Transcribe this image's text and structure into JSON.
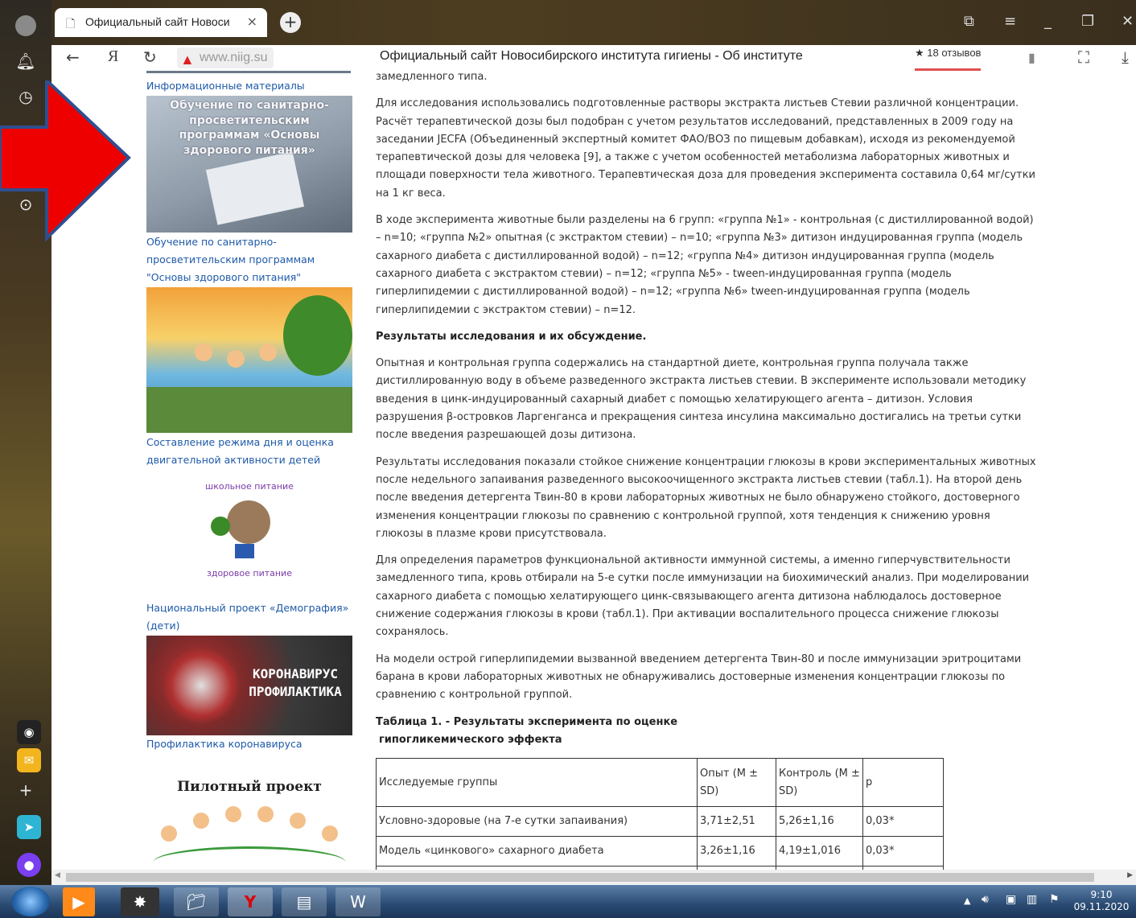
{
  "browser": {
    "tab_title": "Официальный сайт Новоси",
    "url": "www.niig.su",
    "page_title": "Официальный сайт Новосибирского института гигиены - Об институте",
    "reviews": "18 отзывов"
  },
  "sidebar_left": {
    "top_link": "Информационные материалы",
    "banner1_title": "Обучение по санитарно-просветительским программам «Основы здорового питания»",
    "link1": "Обучение по санитарно-просветительским программам \"Основы здорового питания\"",
    "link2": "Составление режима дня и оценка двигательной активности детей",
    "logo_top_text": "школьное питание",
    "logo_bottom_text": "здоровое питание",
    "link3": "Национальный проект «Демография» (дети)",
    "covid_text_1": "КОРОНАВИРУС",
    "covid_text_2": "ПРОФИЛАКТИКА",
    "link4": "Профилактика коронавируса",
    "pilot": "Пилотный проект"
  },
  "article": {
    "p0": "замедленного типа.",
    "p1": "Для исследования использовались подготовленные растворы экстракта листьев Стевии различной концентрации. Расчёт терапевтической дозы был подобран с учетом результатов исследований, представленных в 2009 году на заседании JECFA (Объединенный экспертный комитет ФАО/ВОЗ по пищевым добавкам), исходя из рекомендуемой терапевтической дозы для человека [9], а также с учетом особенностей метаболизма лабораторных животных и площади поверхности тела животного. Терапевтическая доза для проведения эксперимента составила 0,64 мг/сутки на 1 кг веса.",
    "p2": "В ходе эксперимента животные были разделены на 6 групп: «группа №1» - контрольная (с дистиллированной водой) – n=10; «группа №2» опытная (с экстрактом стевии) – n=10; «группа №3» дитизон индуцированная группа (модель сахарного диабета с дистиллированной водой) – n=12; «группа №4» дитизон индуцированная группа (модель сахарного диабета с экстрактом стевии) – n=12; «группа №5» - tween-индуцированная группа (модель гиперлипидемии с дистиллированной водой) – n=12; «группа №6» tween-индуцированная группа (модель гиперлипидемии с экстрактом стевии) – n=12.",
    "heading": "Результаты исследования и их обсуждение.",
    "p3": "Опытная и контрольная группа содержались на стандартной диете, контрольная группа получала также дистиллированную воду в объеме разведенного экстракта листьев стевии. В эксперименте использовали методику введения в цинк-индуцированный сахарный диабет с помощью хелатирующего агента – дитизон. Условия разрушения β-островков Ларгенганса и прекращения синтеза инсулина максимально достигались на третьи сутки после введения разрешающей дозы дитизона.",
    "p4": "Результаты исследования показали стойкое снижение концентрации глюкозы в крови экспериментальных животных после недельного запаивания разведенного высокоочищенного экстракта листьев стевии (табл.1). На второй день после введения детергента Твин-80 в крови лабораторных животных не было обнаружено стойкого, достоверного изменения концентрации глюкозы по сравнению с контрольной группой, хотя тенденция к снижению уровня глюкозы в плазме крови присутствовала.",
    "p5": "Для определения параметров функциональной активности иммунной системы, а именно гиперчувствительности замедленного типа, кровь отбирали на 5-е сутки после иммунизации на биохимический анализ. При моделировании сахарного диабета с помощью хелатирующего цинк-связывающего агента дитизона наблюдалось достоверное снижение содержания глюкозы в крови (табл.1). При активации воспалительного процесса снижение глюкозы сохранялось.",
    "p6": "На модели острой гиперлипидемии вызванной введением детергента Твин-80 и после иммунизации эритроцитами барана в крови лабораторных животных не обнаруживались достоверные изменения концентрации глюкозы по сравнению с контрольной группой.",
    "table_caption_1": "Таблица 1. - Результаты эксперимента по оценке",
    "table_caption_2": "гипогликемического эффекта",
    "table": {
      "headers": [
        "Исследуемые группы",
        "Опыт (M ± SD)",
        "Контроль (M ± SD)",
        "p"
      ],
      "rows": [
        [
          "Условно-здоровые (на 7-е сутки запаивания)",
          "3,71±2,51",
          "5,26±1,16",
          "0,03*"
        ],
        [
          "Модель «цинкового» сахарного диабета",
          "3,26±1,16",
          "4,19±1,016",
          "0,03*"
        ]
      ]
    }
  },
  "taskbar": {
    "time": "9:10",
    "date": "09.11.2020"
  },
  "colors": {
    "arrow": "#ee0000",
    "arrow_border": "#2f4f8f",
    "link": "#1e5aa8"
  }
}
